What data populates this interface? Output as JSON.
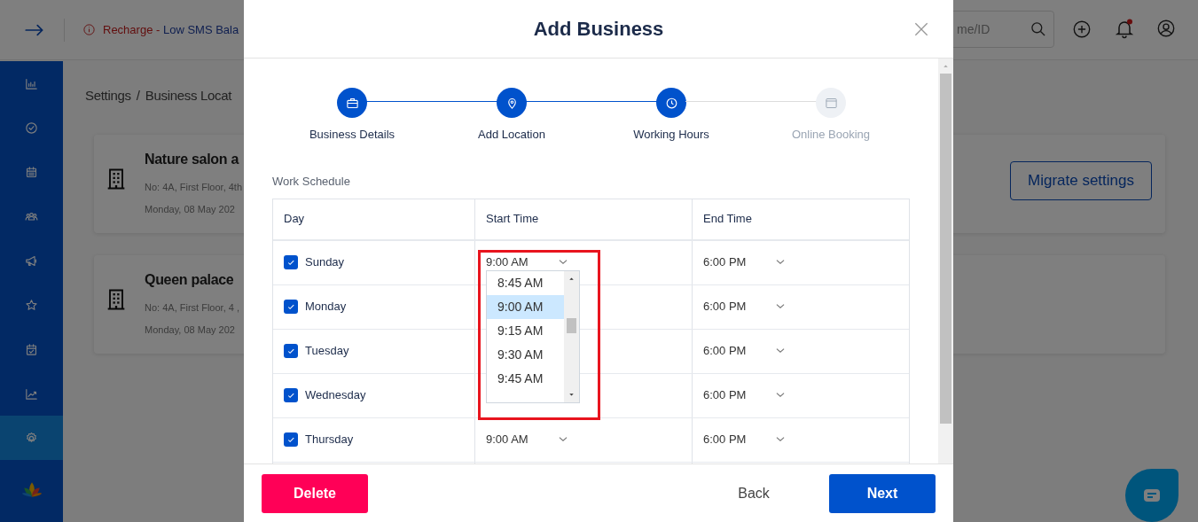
{
  "topbar": {
    "alert": {
      "prefix": "Recharge - ",
      "text": "Low SMS Bala"
    },
    "search": {
      "placeholder": "me/ID"
    }
  },
  "sidebar": {
    "items": [
      {
        "selected": false
      },
      {
        "selected": false
      },
      {
        "selected": false
      },
      {
        "selected": false
      },
      {
        "selected": false
      },
      {
        "selected": false
      },
      {
        "selected": false
      },
      {
        "selected": false
      },
      {
        "selected": true
      }
    ]
  },
  "breadcrumb": [
    "Settings",
    "/",
    "Business Locat"
  ],
  "locations": [
    {
      "name": "Nature salon a",
      "address": "No: 4A, First Floor, 4th",
      "date": "Monday, 08 May 202"
    },
    {
      "name": "Queen palace",
      "address": "No: 4A, First Floor, 4 ,",
      "date": "Monday, 08 May 202"
    }
  ],
  "migrate_button": "Migrate settings",
  "modal": {
    "title": "Add Business",
    "steps": [
      {
        "label": "Business Details",
        "done": true
      },
      {
        "label": "Add Location",
        "done": true
      },
      {
        "label": "Working Hours",
        "done": true
      },
      {
        "label": "Online Booking",
        "done": false
      }
    ],
    "section_title": "Work Schedule",
    "columns": [
      "Day",
      "Start Time",
      "End Time"
    ],
    "rows": [
      {
        "day": "Sunday",
        "checked": true,
        "start": "9:00 AM",
        "end": "6:00 PM",
        "options": [
          {
            "label": "8:45 AM",
            "selected": false
          },
          {
            "label": "9:00 AM",
            "selected": true
          },
          {
            "label": "9:15 AM",
            "selected": false
          },
          {
            "label": "9:30 AM",
            "selected": false
          },
          {
            "label": "9:45 AM",
            "selected": false
          }
        ]
      },
      {
        "day": "Monday",
        "checked": true,
        "end": "6:00 PM"
      },
      {
        "day": "Tuesday",
        "checked": true,
        "end": "6:00 PM"
      },
      {
        "day": "Wednesday",
        "checked": true,
        "end": "6:00 PM"
      },
      {
        "day": "Thursday",
        "checked": true,
        "start": "9:00 AM",
        "end": "6:00 PM"
      }
    ],
    "buttons": {
      "delete": "Delete",
      "back": "Back",
      "next": "Next"
    }
  }
}
